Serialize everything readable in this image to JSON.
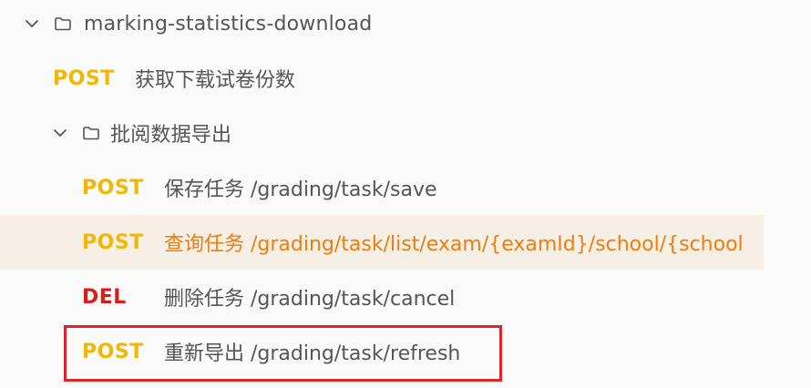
{
  "tree": {
    "root_folder": {
      "label": "marking-statistics-download",
      "chevron_icon": "chevron-down-icon",
      "folder_icon": "folder-icon"
    },
    "root_item": {
      "method": "POST",
      "name": "获取下载试卷份数"
    },
    "sub_folder": {
      "label": "批阅数据导出",
      "chevron_icon": "chevron-down-icon",
      "folder_icon": "folder-icon"
    },
    "endpoints": [
      {
        "method": "POST",
        "name": "保存任务 /grading/task/save"
      },
      {
        "method": "POST",
        "name": "查询任务 /grading/task/list/exam/{examId}/school/{school"
      },
      {
        "method": "DEL",
        "name": "删除任务 /grading/task/cancel"
      },
      {
        "method": "POST",
        "name": "重新导出 /grading/task/refresh"
      }
    ]
  },
  "colors": {
    "post": "#f2b705",
    "del": "#d91e18",
    "selected_text": "#ee7d0d",
    "selected_bg": "#f6efe6",
    "highlight_border": "#d8282e"
  }
}
